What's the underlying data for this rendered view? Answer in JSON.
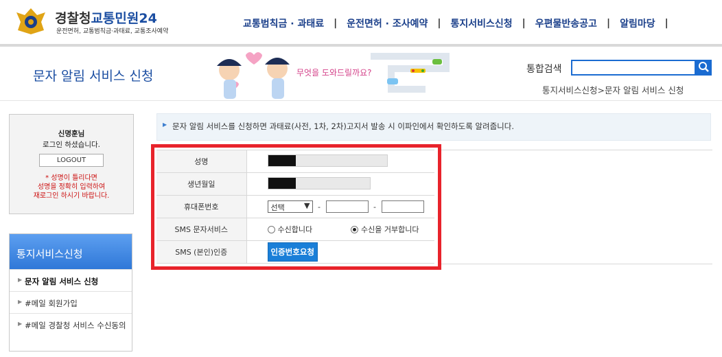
{
  "header": {
    "logo_title_a": "경찰청",
    "logo_title_b": "교통민원24",
    "logo_sub": "운전면허, 교통범칙금·과태료, 교통조사예약",
    "nav": [
      "교통범칙금 · 과태료",
      "운전면허 · 조사예약",
      "통지서비스신청",
      "우편물반송공고",
      "알림마당"
    ],
    "nav_sep": "|"
  },
  "page": {
    "title": "문자 알림 서비스 신청",
    "mascot_caption": "무엇을 도와드릴까요?",
    "search_label": "통합검색",
    "search_placeholder": "",
    "breadcrumb": "통지서비스신청>문자 알림 서비스 신청"
  },
  "login": {
    "name": "신명훈님",
    "msg": "로그인 하셨습니다.",
    "logout": "LOGOUT",
    "warn_1": "* 성명이 틀리다면",
    "warn_2": "성명을 정확히 입력하여",
    "warn_3": "재로그인 하시기 바랍니다."
  },
  "side_menu": {
    "head": "통지서비스신청",
    "items": [
      "문자 알림 서비스 신청",
      "#메일 회원가입",
      "#메일 경찰청 서비스 수신동의"
    ]
  },
  "notice": "문자 알림 서비스를 신청하면 과태료(사전, 1차, 2차)고지서 발송 시 이파인에서 확인하도록 알려줍니다.",
  "form": {
    "labels": [
      "성명",
      "생년월일",
      "휴대폰번호",
      "SMS 문자서비스",
      "SMS (본인)인증"
    ],
    "phone_select": "선택",
    "phone_dash": "-",
    "sms_opt_in": "수신합니다",
    "sms_opt_out": "수신을 거부합니다",
    "sms_selected": "opt_out",
    "verify_button": "인증번호요청"
  },
  "colors": {
    "brand_blue": "#1a4da1",
    "button_blue": "#1a7fd8",
    "highlight_red": "#e8232b",
    "warn_red": "#cc1111"
  }
}
